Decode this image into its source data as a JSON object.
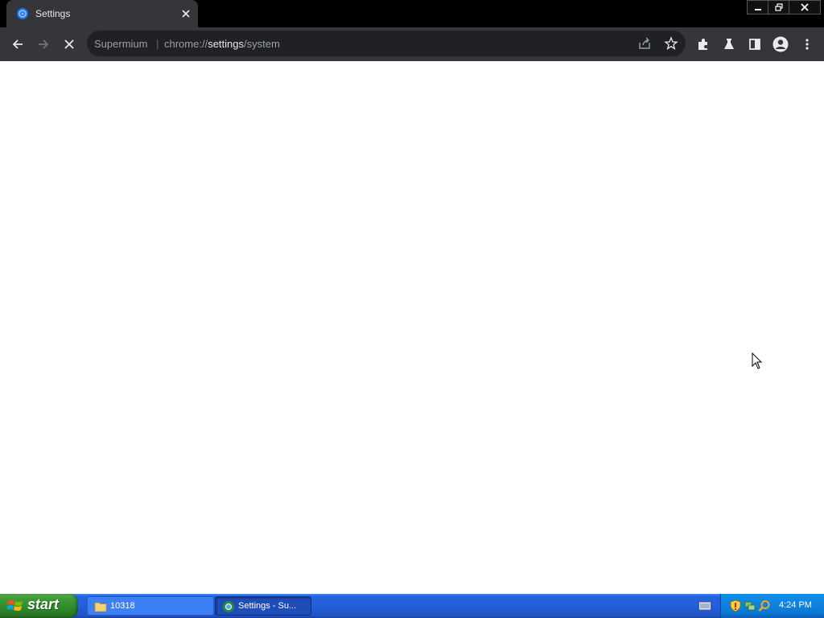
{
  "browser": {
    "tab": {
      "title": "Settings",
      "favicon": "settings-gear-icon",
      "close_icon": "close-icon"
    },
    "window_controls": [
      "minimize-icon",
      "restore-icon",
      "close-icon"
    ],
    "toolbar": {
      "back_icon": "arrow-left-icon",
      "forward_icon": "arrow-right-icon",
      "stop_icon": "stop-x-icon",
      "omnibox": {
        "origin": "Supermium",
        "separator": "|",
        "scheme": "chrome://",
        "host": "settings",
        "path": "/system"
      },
      "right_icons": [
        "share-icon",
        "star-icon",
        "puzzle-icon",
        "flask-icon",
        "side-panel-icon",
        "profile-icon",
        "menu-icon"
      ]
    }
  },
  "taskbar": {
    "start_label": "start",
    "tasks": [
      {
        "label": "10318",
        "icon": "folder-icon"
      },
      {
        "label": "Settings - Su...",
        "icon": "browser-icon"
      }
    ],
    "clock": "4:24 PM"
  },
  "colors": {
    "toolbar": "#35363a",
    "omnibox": "#202124",
    "taskbar": "#245edb",
    "start": "#3c9c35"
  }
}
